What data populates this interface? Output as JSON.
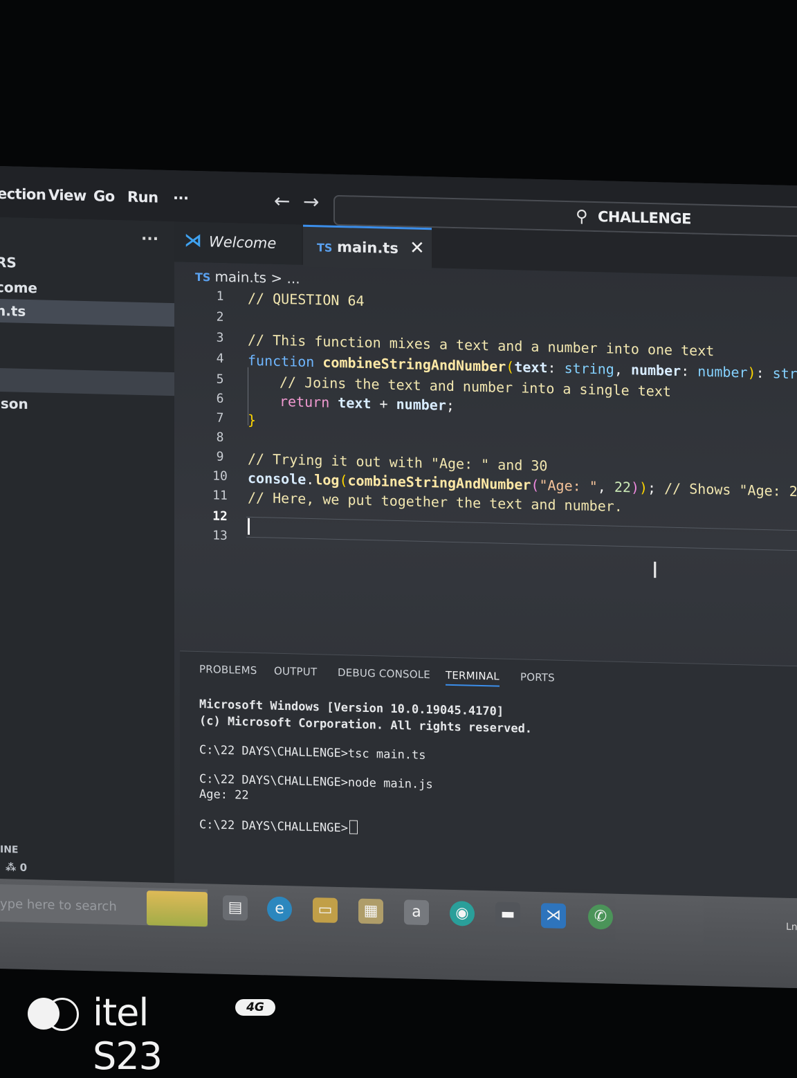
{
  "menu": {
    "items": [
      "ection",
      "View",
      "Go",
      "Run"
    ],
    "more": "···"
  },
  "nav": {
    "back_icon": "arrow-left-icon",
    "forward_icon": "arrow-right-icon"
  },
  "command_center": {
    "label": "CHALLENGE",
    "icon": "search-icon"
  },
  "sidebar": {
    "more": "···",
    "rows": [
      "RS",
      "come",
      "n.ts",
      "json"
    ],
    "outline": "INE",
    "ports": "⁂ 0"
  },
  "tabs": [
    {
      "label": "Welcome",
      "icon": "vscode-icon"
    },
    {
      "label": "main.ts",
      "badge": "TS",
      "close": "✕"
    }
  ],
  "breadcrumb": {
    "badge": "TS",
    "file": "main.ts",
    "sep": ">",
    "rest": "..."
  },
  "editor": {
    "line_numbers": [
      "1",
      "2",
      "3",
      "4",
      "5",
      "6",
      "7",
      "8",
      "9",
      "10",
      "11",
      "12",
      "13"
    ],
    "active_line": "12"
  },
  "panel": {
    "tabs": [
      "PROBLEMS",
      "OUTPUT",
      "DEBUG CONSOLE",
      "TERMINAL",
      "PORTS"
    ],
    "active_tab": "TERMINAL",
    "terminal_lines": [
      "Microsoft Windows [Version 10.0.19045.4170]",
      "(c) Microsoft Corporation. All rights reserved.",
      "C:\\22 DAYS\\CHALLENGE>tsc main.ts",
      "C:\\22 DAYS\\CHALLENGE>node main.js",
      "Age: 22",
      "C:\\22 DAYS\\CHALLENGE>"
    ]
  },
  "taskbar": {
    "search_placeholder": "ype here to search",
    "clock_fragment": "Ln"
  },
  "watermark": {
    "brand": "itel S23",
    "badge": "4G"
  }
}
